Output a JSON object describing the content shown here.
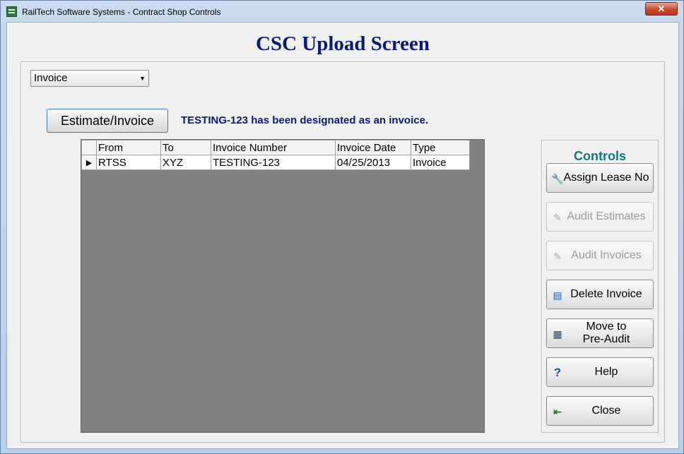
{
  "window": {
    "title": "RailTech Software Systems - Contract Shop Controls",
    "close_glyph": "✕"
  },
  "screen": {
    "title": "CSC Upload Screen"
  },
  "doc_type_select": {
    "value": "Invoice",
    "arrow": "▼"
  },
  "estimate_button": {
    "label": "Estimate/Invoice"
  },
  "status_message": "TESTING-123 has been designated as an invoice.",
  "grid": {
    "columns": [
      "From",
      "To",
      "Invoice Number",
      "Invoice Date",
      "Type"
    ],
    "rows": [
      {
        "marker": "▶",
        "cells": [
          "RTSS",
          "XYZ",
          "TESTING-123",
          "04/25/2013",
          "Invoice"
        ]
      }
    ]
  },
  "controls": {
    "title": "Controls",
    "buttons": [
      {
        "label": "Assign Lease No",
        "icon": "wrench-icon",
        "glyph": "🔧",
        "enabled": true
      },
      {
        "label": "Audit Estimates",
        "icon": "check-edit-icon",
        "glyph": "✎",
        "enabled": false
      },
      {
        "label": "Audit Invoices",
        "icon": "check-edit-icon",
        "glyph": "✎",
        "enabled": false
      },
      {
        "label": "Delete Invoice",
        "icon": "delete-grid-icon",
        "glyph": "▤",
        "enabled": true
      },
      {
        "label_line1": "Move to",
        "label_line2": "Pre-Audit",
        "icon": "move-grid-icon",
        "glyph": "▦",
        "enabled": true
      },
      {
        "label": "Help",
        "icon": "help-icon",
        "glyph": "?",
        "enabled": true
      },
      {
        "label": "Close",
        "icon": "exit-door-icon",
        "glyph": "⇤",
        "enabled": true
      }
    ]
  },
  "colors": {
    "title_navy": "#0a1a7a",
    "controls_teal": "#0e7c7b",
    "grid_bg": "#808080"
  }
}
